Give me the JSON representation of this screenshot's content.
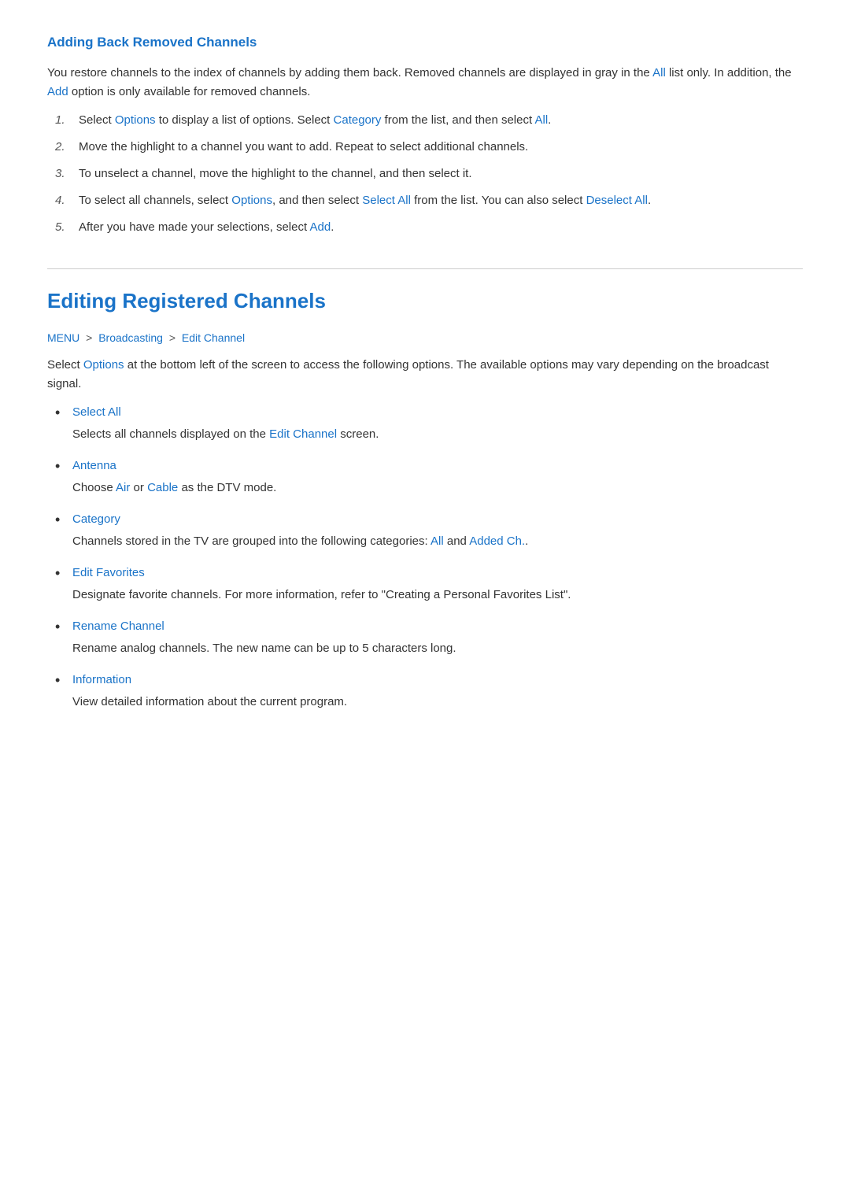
{
  "section1": {
    "title": "Adding Back Removed Channels",
    "intro": "You restore channels to the index of channels by adding them back. Removed channels are displayed in gray in the ",
    "intro_link1": "All",
    "intro_mid": " list only. In addition, the ",
    "intro_link2": "Add",
    "intro_end": " option is only available for removed channels.",
    "steps": [
      {
        "num": "1.",
        "text_before": "Select ",
        "link1": "Options",
        "text_mid": " to display a list of options. Select ",
        "link2": "Category",
        "text_end": " from the list, and then select ",
        "link3": "All",
        "text_final": "."
      },
      {
        "num": "2.",
        "text": "Move the highlight to a channel you want to add. Repeat to select additional channels."
      },
      {
        "num": "3.",
        "text": "To unselect a channel, move the highlight to the channel, and then select it."
      },
      {
        "num": "4.",
        "text_before": "To select all channels, select ",
        "link1": "Options",
        "text_mid": ", and then select ",
        "link2": "Select All",
        "text_end": " from the list. You can also select ",
        "link3": "Deselect All",
        "text_final": "."
      },
      {
        "num": "5.",
        "text_before": "After you have made your selections, select ",
        "link1": "Add",
        "text_end": "."
      }
    ]
  },
  "section2": {
    "title": "Editing Registered Channels",
    "breadcrumb": {
      "part1": "MENU",
      "separator1": ">",
      "part2": "Broadcasting",
      "separator2": ">",
      "part3": "Edit Channel"
    },
    "intro_before": "Select ",
    "intro_link": "Options",
    "intro_after": " at the bottom left of the screen to access the following options. The available options may vary depending on the broadcast signal.",
    "items": [
      {
        "title": "Select All",
        "desc_before": "Selects all channels displayed on the ",
        "desc_link": "Edit Channel",
        "desc_after": " screen."
      },
      {
        "title": "Antenna",
        "desc_before": "Choose ",
        "desc_link1": "Air",
        "desc_mid": " or ",
        "desc_link2": "Cable",
        "desc_after": " as the DTV mode."
      },
      {
        "title": "Category",
        "desc_before": "Channels stored in the TV are grouped into the following categories: ",
        "desc_link1": "All",
        "desc_mid": " and ",
        "desc_link2": "Added Ch.",
        "desc_after": "."
      },
      {
        "title": "Edit Favorites",
        "desc": "Designate favorite channels. For more information, refer to \"Creating a Personal Favorites List\"."
      },
      {
        "title": "Rename Channel",
        "desc": "Rename analog channels. The new name can be up to 5 characters long."
      },
      {
        "title": "Information",
        "desc": "View detailed information about the current program."
      }
    ]
  }
}
